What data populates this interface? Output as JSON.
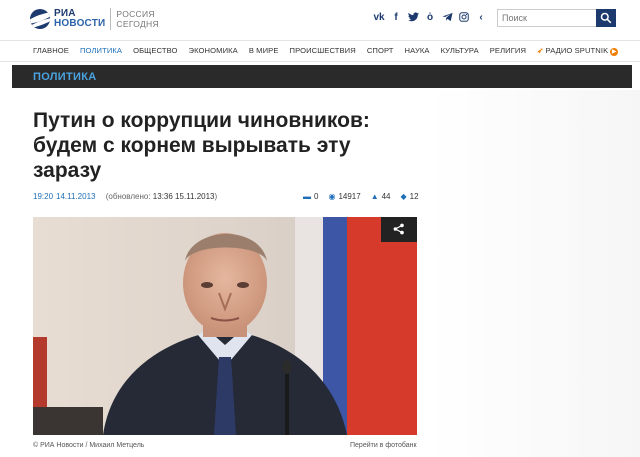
{
  "header": {
    "logo_line1": "РИА",
    "logo_line2": "НОВОСТИ",
    "logo_sub1": "РОССИЯ",
    "logo_sub2": "СЕГОДНЯ",
    "social_icons": [
      "vk-icon",
      "facebook-icon",
      "twitter-icon",
      "odnoklassniki-icon",
      "telegram-icon",
      "instagram-icon",
      "collapse-icon"
    ],
    "search_placeholder": "Поиск"
  },
  "nav": {
    "items": [
      "Главное",
      "Политика",
      "Общество",
      "Экономика",
      "В мире",
      "Происшествия",
      "Спорт",
      "Наука",
      "Культура",
      "Религия"
    ],
    "sputnik_label": "Радио Sputnik",
    "active": "Политика"
  },
  "section": {
    "label": "ПОЛИТИКА"
  },
  "article": {
    "title": "Путин о коррупции чиновников: будем с корнем вырывать эту заразу",
    "time": "19:20",
    "date": "14.11.2013",
    "updated_prefix": "(обновлено:",
    "updated_value": "13:36 15.11.2013",
    "updated_suffix": ")",
    "stats": {
      "comments": "0",
      "views": "14917",
      "likes": "44",
      "shares": "12"
    },
    "photo_caption": "© РИА Новости / Михаил Метцель",
    "gallery_link": "Перейти в фотобанк"
  },
  "colors": {
    "brand_navy": "#1d3a6e",
    "accent_blue": "#1e6fb8",
    "section_bg": "#2a2a2a",
    "sputnik_orange": "#ef7d00"
  }
}
